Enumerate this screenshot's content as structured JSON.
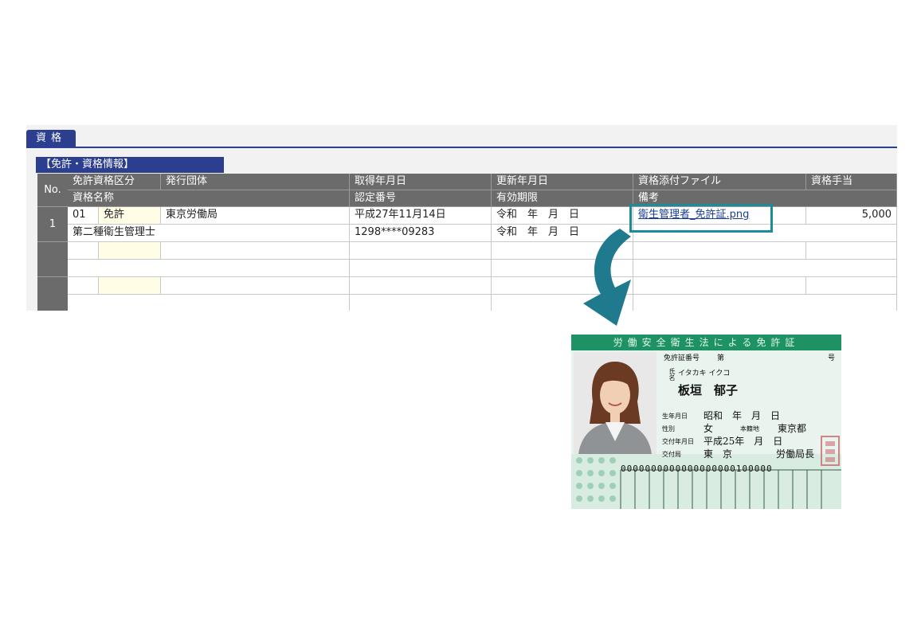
{
  "tab": {
    "label": "資格"
  },
  "section": {
    "title": "【免許・資格情報】"
  },
  "table": {
    "no_header": "No.",
    "header_row1": [
      "免許資格区分",
      "発行団体",
      "取得年月日",
      "更新年月日",
      "資格添付ファイル",
      "資格手当"
    ],
    "header_row2": [
      "資格名称",
      "認定番号",
      "有効期限",
      "備考"
    ],
    "rows": [
      {
        "no": "1",
        "code": "01",
        "type": "免許",
        "issuer": "東京労働局",
        "acquired": "平成27年11月14日",
        "renewed": "令和　年　月　日",
        "file": "衛生管理者_免許証.png",
        "allowance": "5,000",
        "name": "第二種衛生管理士",
        "cert_no": "1298****09283",
        "expiry": "令和　年　月　日",
        "note": ""
      }
    ]
  },
  "card": {
    "title": "労働安全衛生法による免許証",
    "license_label": "免許証番号",
    "license_prefix": "第",
    "license_suffix": "号",
    "furigana": "イタカキ イクコ",
    "name": "板垣　郁子",
    "name_label": "氏名",
    "birth_label": "生年月日",
    "birth_value": "昭和　年　月　日",
    "sex_label": "性別",
    "sex_value": "女",
    "domicile_label": "本籍地",
    "domicile_value": "東京都",
    "issue_date_label": "交付年月日",
    "issue_date_value": "平成25年　月　日",
    "issuer_label": "交付局",
    "issuer_place": "東　京",
    "issuer_value": "労働局長",
    "digits": "0000000000000000000100000"
  },
  "colors": {
    "navy": "#2c3e8f",
    "teal": "#1e7a8c",
    "card_green": "#1e9264"
  }
}
